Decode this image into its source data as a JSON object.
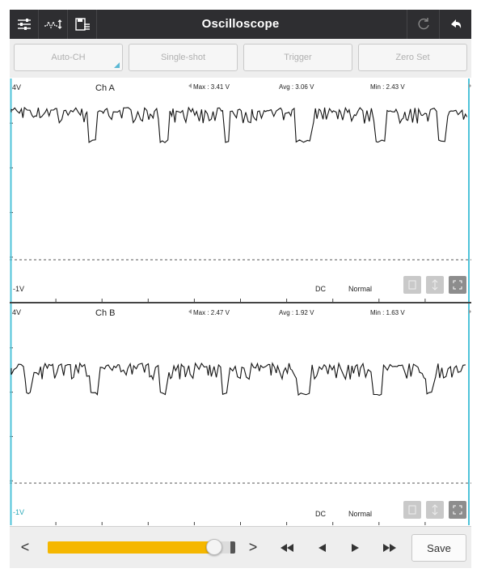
{
  "app": {
    "title": "Oscilloscope",
    "icons_left": [
      "settings-sliders-icon",
      "waveform-measure-icon",
      "save-file-icon"
    ],
    "icons_right": [
      "refresh-icon",
      "back-arrow-icon"
    ]
  },
  "toolbar": {
    "auto_ch": "Auto-CH",
    "single_shot": "Single-shot",
    "trigger": "Trigger",
    "zero_set": "Zero Set"
  },
  "channels": [
    {
      "name": "Ch A",
      "top_label": "4V",
      "bottom_label": "-1V",
      "max": "Max : 3.41 V",
      "avg": "Avg : 3.06 V",
      "min": "Min : 2.43 V",
      "coupling": "DC",
      "mode": "Normal",
      "high_level_v": 3.3,
      "low_level_v": 2.5
    },
    {
      "name": "Ch B",
      "top_label": "4V",
      "bottom_label": "-1V",
      "max": "Max : 2.47 V",
      "avg": "Avg : 1.92 V",
      "min": "Min : 1.63 V",
      "coupling": "DC",
      "mode": "Normal",
      "high_level_v": 2.4,
      "low_level_v": 1.7
    }
  ],
  "bottom": {
    "prev": "<",
    "next": ">",
    "progress": 0.91,
    "save": "Save"
  },
  "colors": {
    "accent": "#f5b700",
    "cursor": "#4fc3d9",
    "titlebar": "#2e2e31"
  }
}
